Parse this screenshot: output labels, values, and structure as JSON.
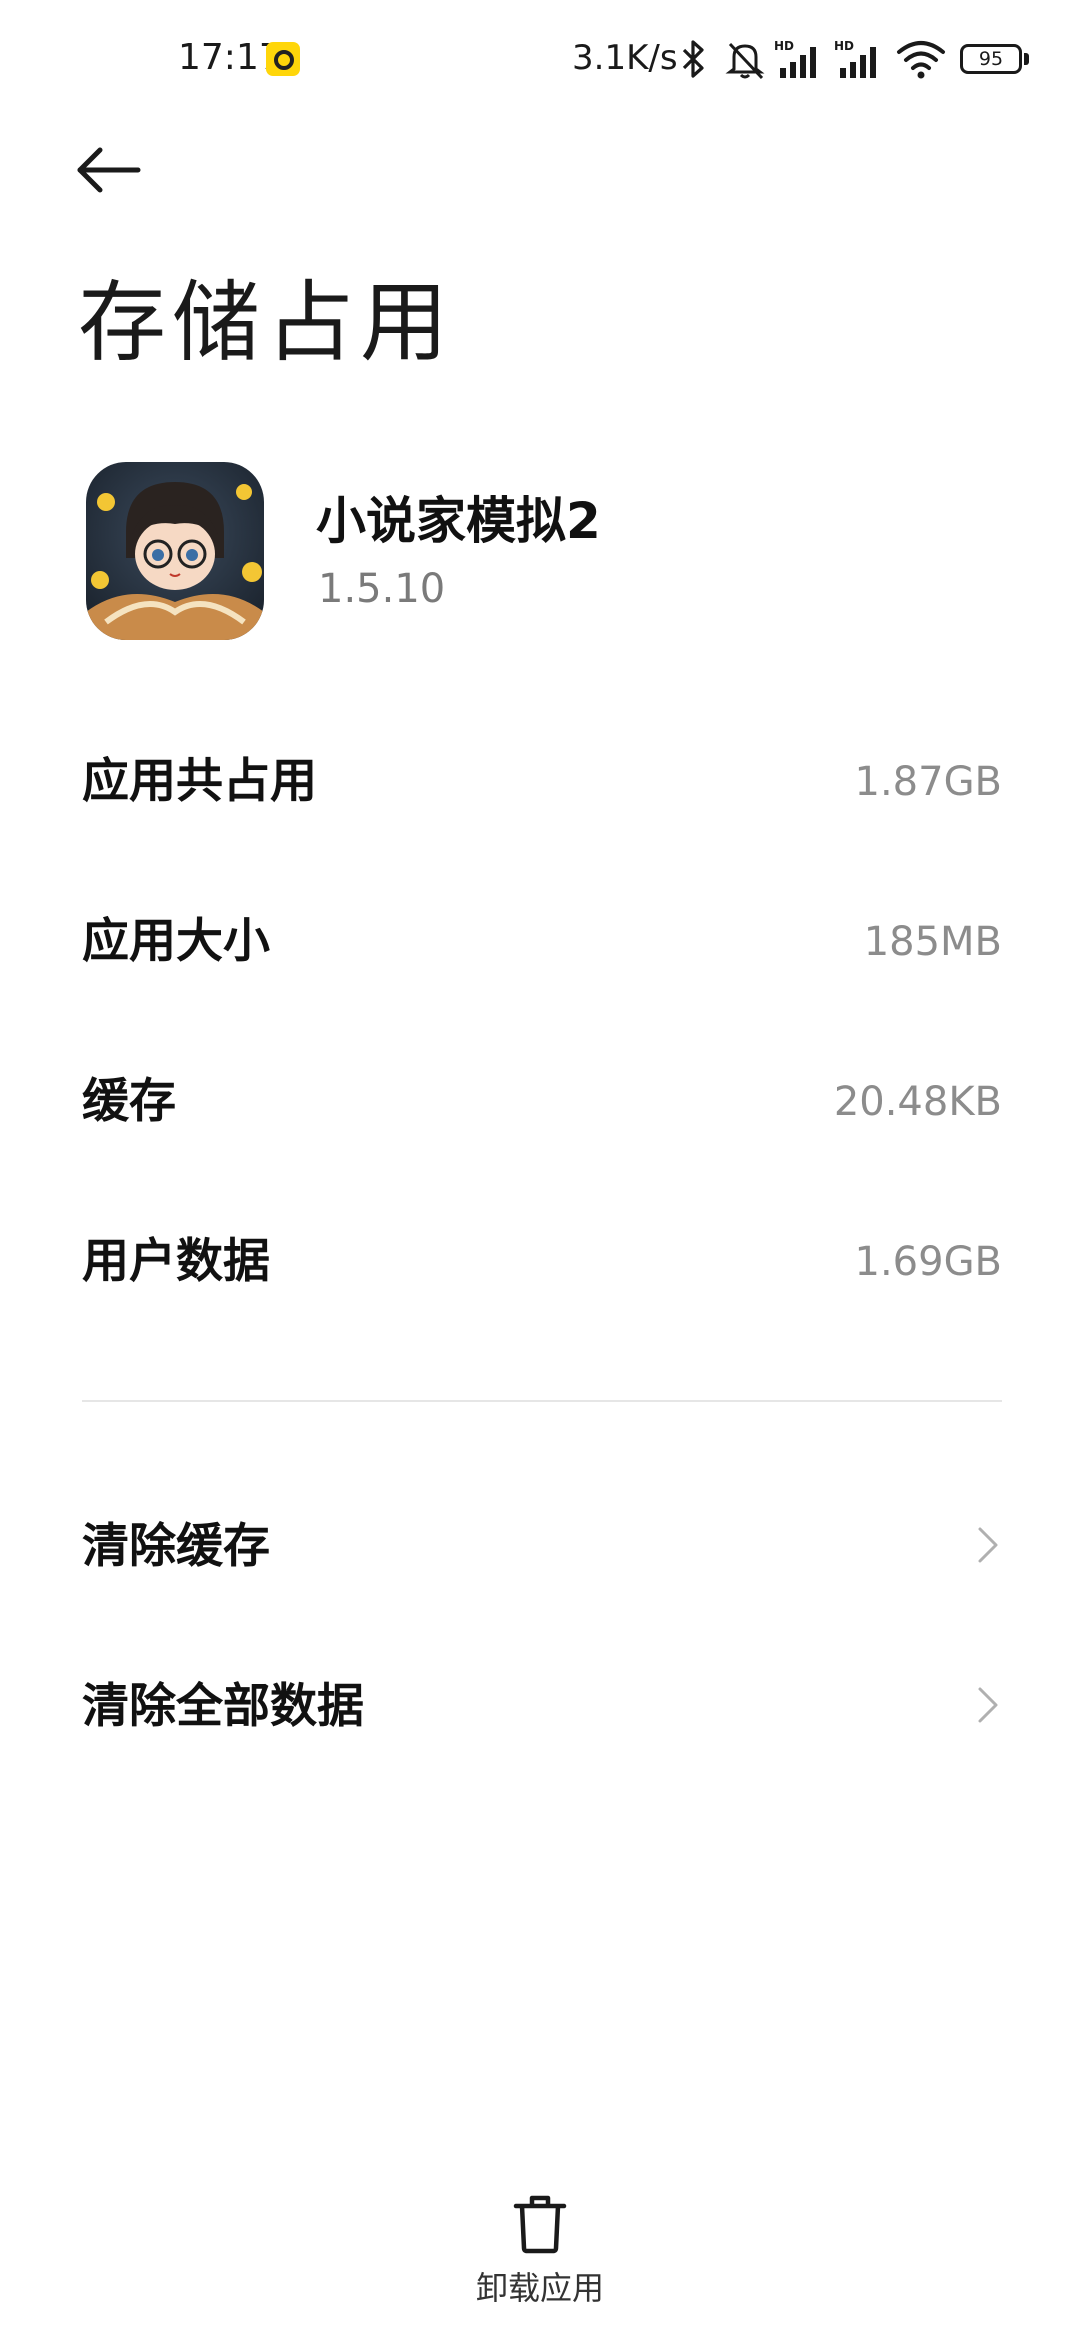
{
  "status_bar": {
    "time": "17:17",
    "network_speed": "3.1K/s",
    "battery_level": "95",
    "icons": [
      "notification-badge-icon",
      "bluetooth-icon",
      "mute-bell-icon",
      "hd-signal-icon",
      "hd-signal-icon",
      "wifi-icon",
      "battery-icon"
    ]
  },
  "header": {
    "back_icon": "arrow-left-icon",
    "title": "存储占用"
  },
  "app": {
    "name": "小说家模拟2",
    "version": "1.5.10"
  },
  "storage": [
    {
      "label": "应用共占用",
      "value": "1.87GB"
    },
    {
      "label": "应用大小",
      "value": "185MB"
    },
    {
      "label": "缓存",
      "value": "20.48KB"
    },
    {
      "label": "用户数据",
      "value": "1.69GB"
    }
  ],
  "actions": [
    {
      "label": "清除缓存"
    },
    {
      "label": "清除全部数据"
    }
  ],
  "bottom": {
    "uninstall_label": "卸载应用",
    "uninstall_icon": "trash-icon"
  }
}
